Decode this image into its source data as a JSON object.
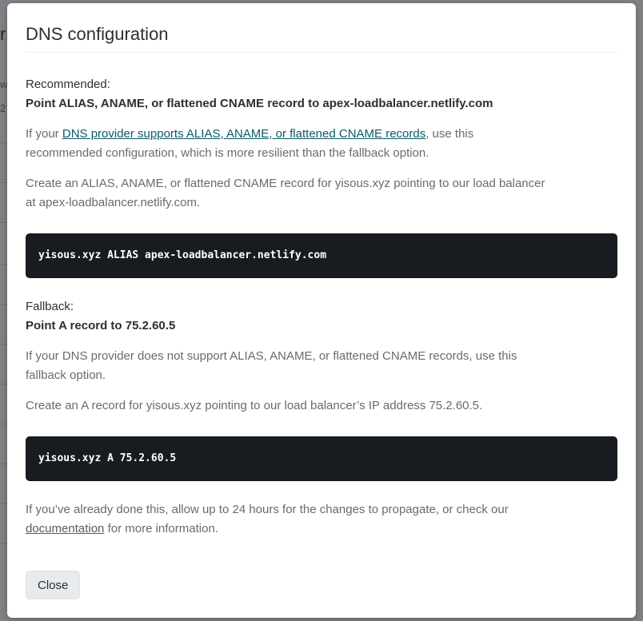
{
  "backdrop": {
    "partial_letter": "ri",
    "partial_small_1": "w",
    "partial_small_2": "2"
  },
  "dialog": {
    "title": "DNS configuration",
    "recommended": {
      "kicker": "Recommended:",
      "heading": "Point ALIAS, ANAME, or flattened CNAME record to apex-loadbalancer.netlify.com",
      "para1_prefix": "If your ",
      "para1_link": "DNS provider supports ALIAS, ANAME, or flattened CNAME records",
      "para1_suffix": ", use this recommended configuration, which is more resilient than the fallback option.",
      "para2": "Create an ALIAS, ANAME, or flattened CNAME record for yisous.xyz pointing to our load balancer at apex-loadbalancer.netlify.com.",
      "code": "yisous.xyz ALIAS apex-loadbalancer.netlify.com"
    },
    "fallback": {
      "kicker": "Fallback:",
      "heading": "Point A record to 75.2.60.5",
      "para1": "If your DNS provider does not support ALIAS, ANAME, or flattened CNAME records, use this fallback option.",
      "para2": "Create an A record for yisous.xyz pointing to our load balancer’s IP address 75.2.60.5.",
      "code": "yisous.xyz A 75.2.60.5"
    },
    "footer_prefix": "If you’ve already done this, allow up to 24 hours for the changes to propagate, or check our ",
    "footer_link": "documentation",
    "footer_suffix": " for more information.",
    "close_label": "Close"
  }
}
